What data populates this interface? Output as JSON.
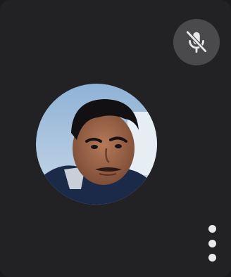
{
  "participant_tile": {
    "mic_status_icon": "mic-off-icon",
    "avatar_icon": "participant-avatar",
    "more_options_icon": "more-vert-icon"
  },
  "colors": {
    "tile_background": "#222124",
    "badge_background": "#4a494c",
    "icon_foreground": "#e9e9ec"
  }
}
